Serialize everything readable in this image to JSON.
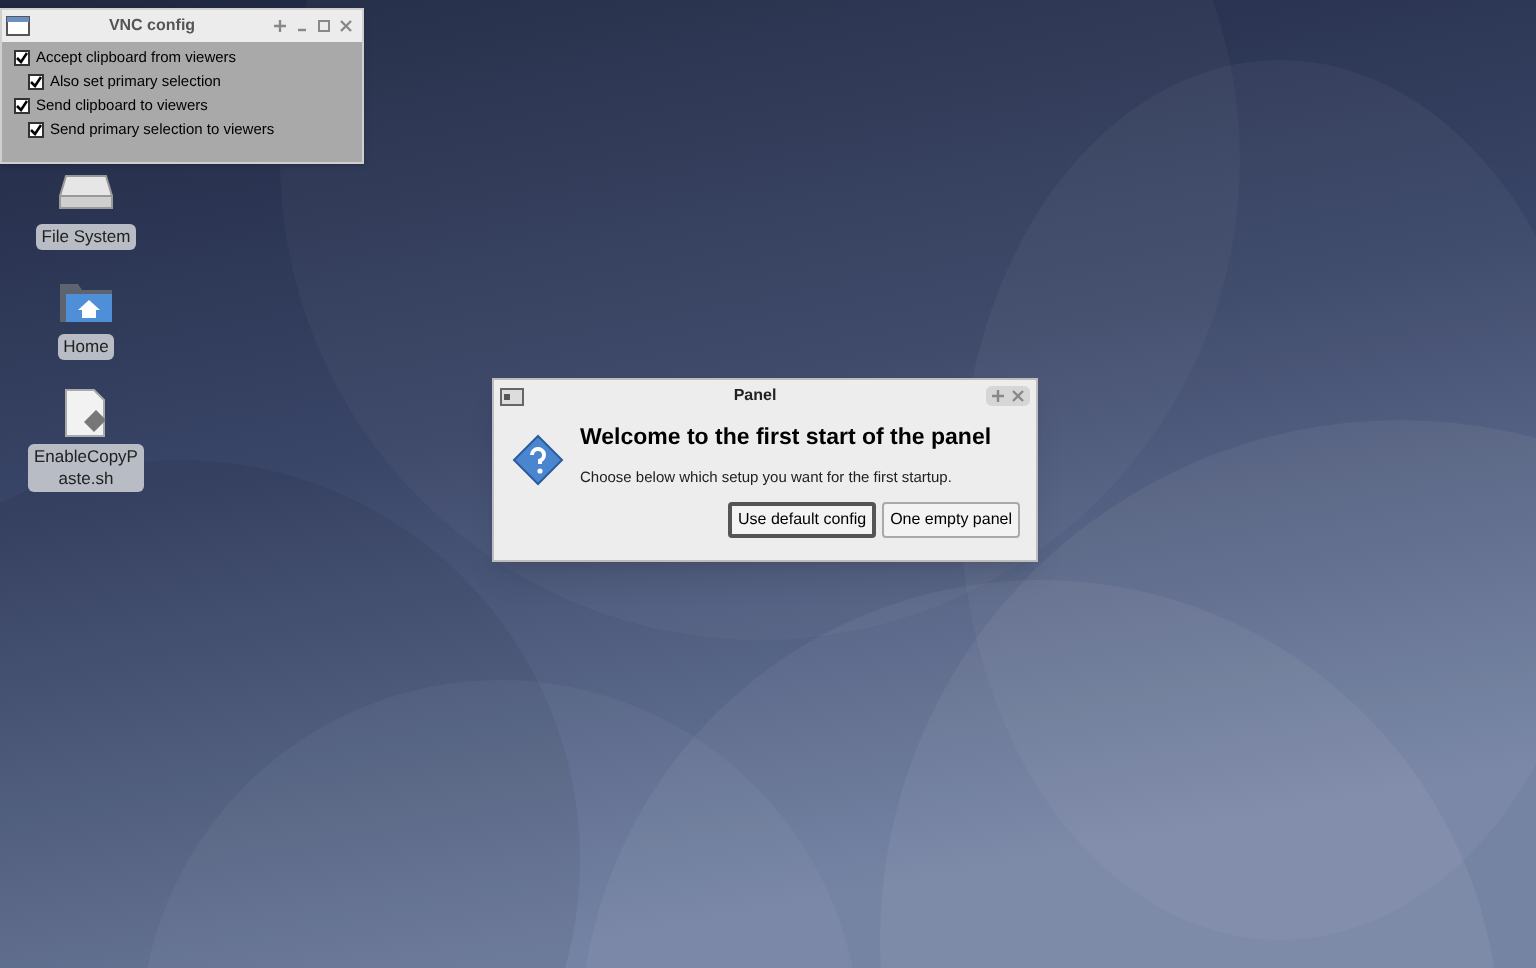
{
  "vnc_window": {
    "title": "VNC config",
    "options": [
      {
        "label": "Accept clipboard from viewers",
        "checked": true,
        "children": [
          {
            "label": "Also set primary selection",
            "checked": true
          }
        ]
      },
      {
        "label": "Send clipboard to viewers",
        "checked": true,
        "children": [
          {
            "label": "Send primary selection to viewers",
            "checked": true
          }
        ]
      }
    ]
  },
  "desktop_icons": [
    {
      "kind": "drive",
      "label": "File System"
    },
    {
      "kind": "home",
      "label": "Home"
    },
    {
      "kind": "script",
      "label": "EnableCopyP aste.sh"
    }
  ],
  "panel_dialog": {
    "title": "Panel",
    "heading": "Welcome to the first start of the panel",
    "message": "Choose below which setup you want for the first startup.",
    "buttons": [
      {
        "label": "Use default config",
        "selected": true
      },
      {
        "label": "One empty panel",
        "selected": false
      }
    ]
  }
}
